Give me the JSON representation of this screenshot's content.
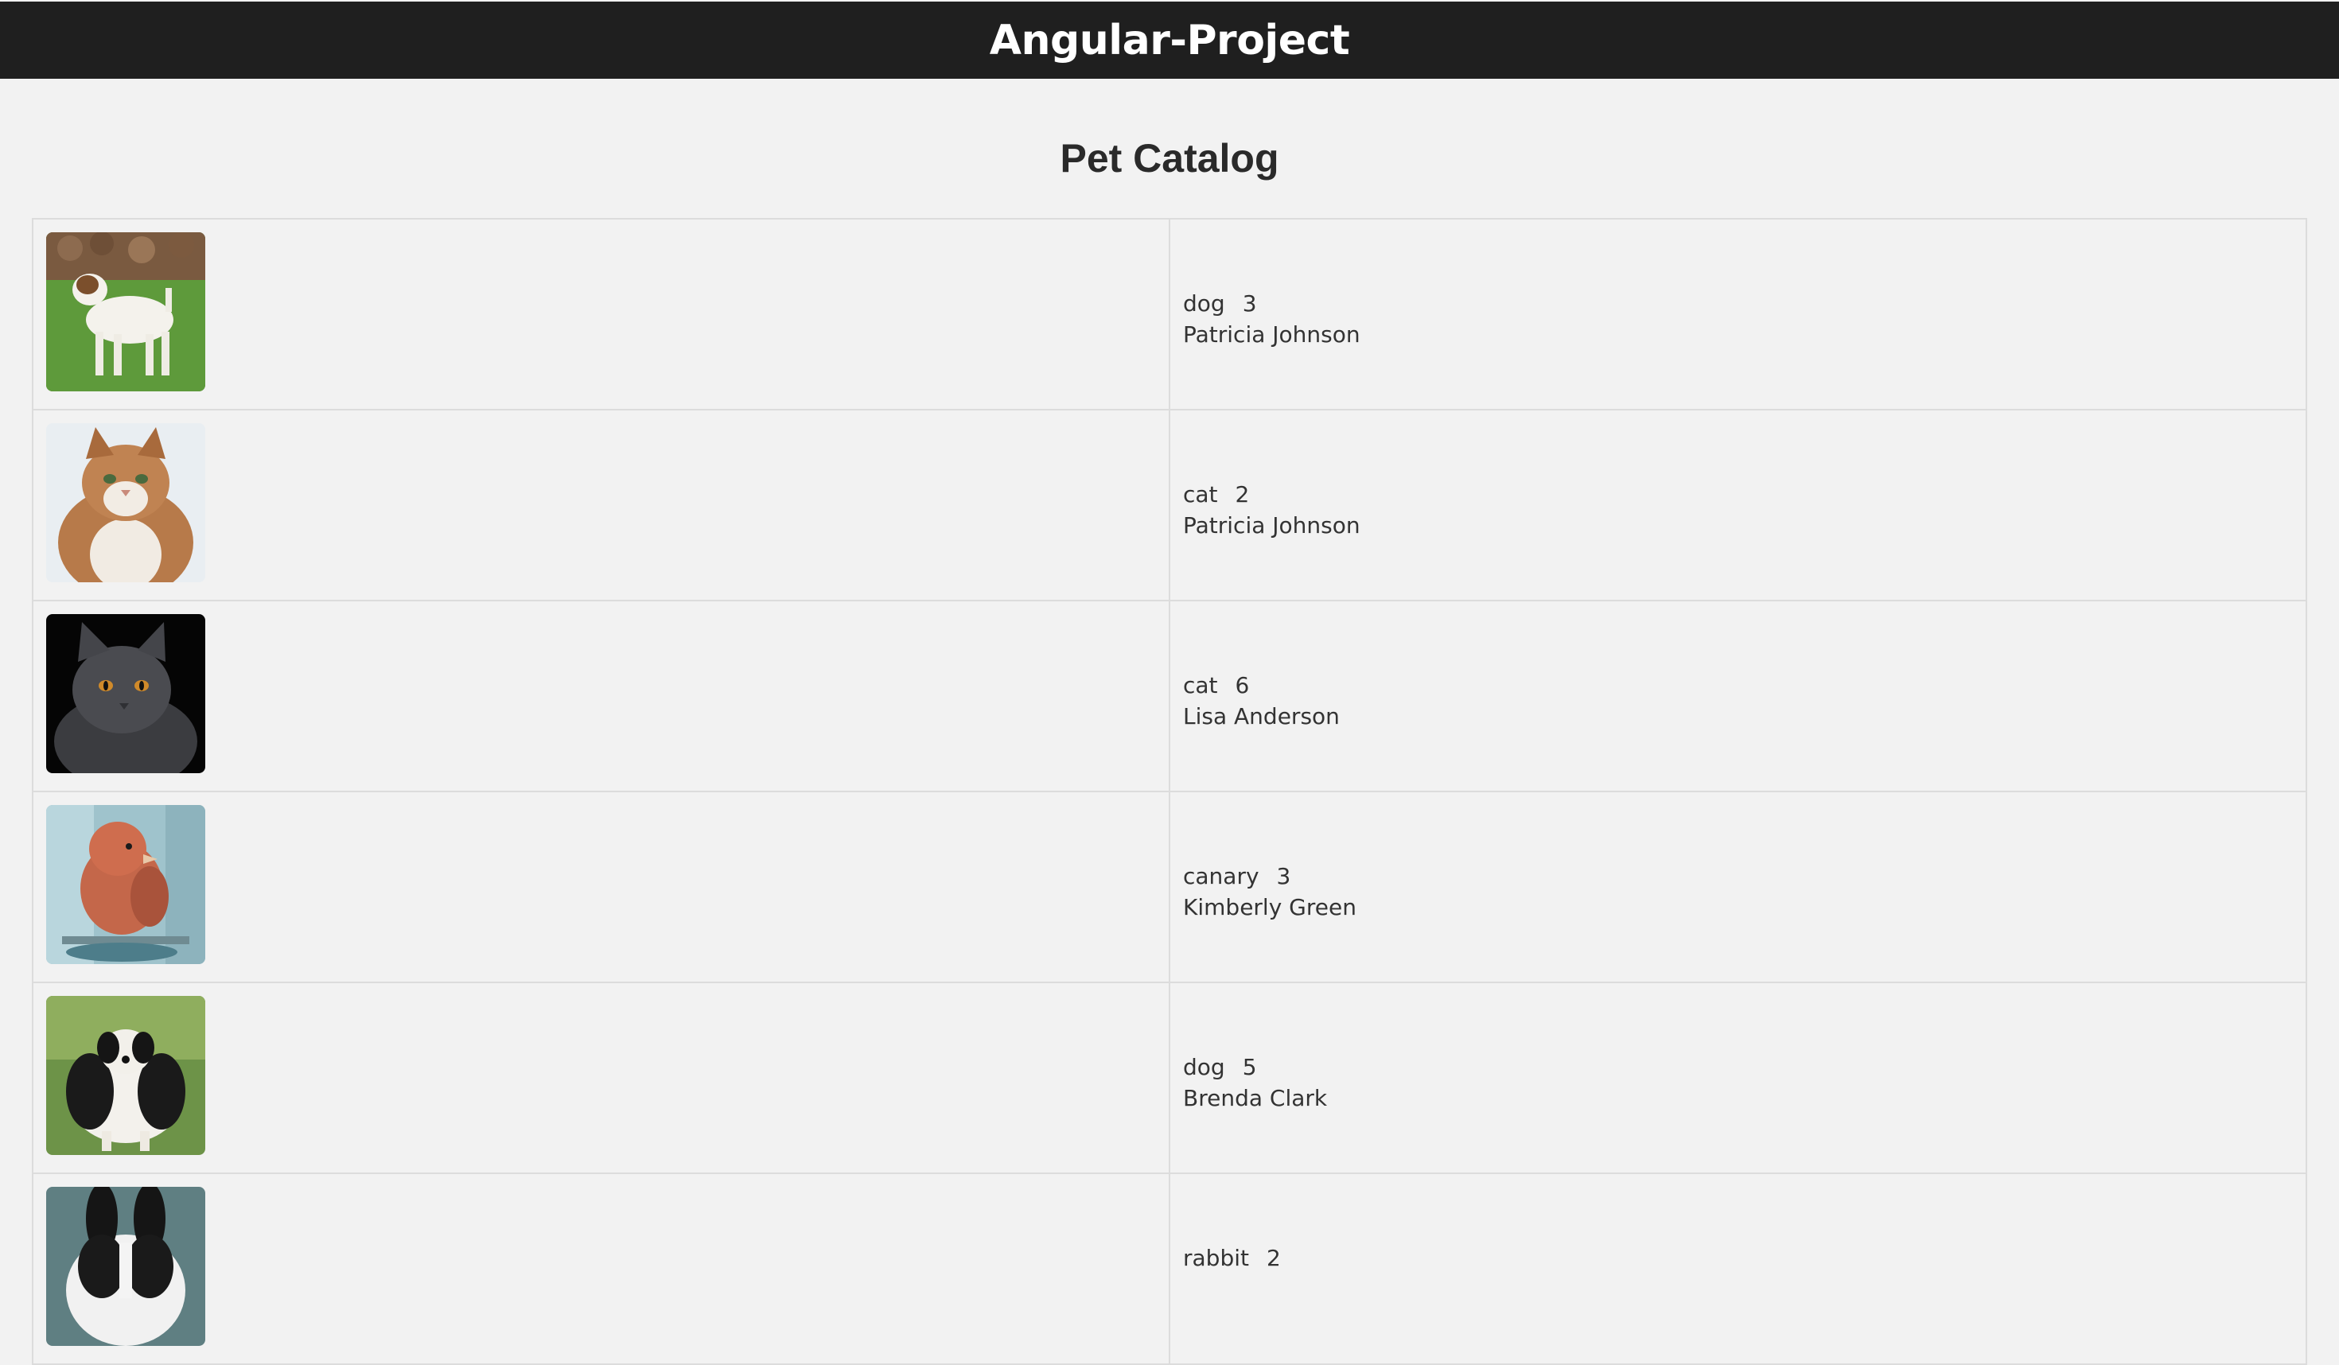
{
  "app": {
    "title": "Angular-Project"
  },
  "page": {
    "heading": "Pet Catalog"
  },
  "pets": [
    {
      "type": "dog",
      "age": "3",
      "owner": "Patricia Johnson",
      "photo_icon": "jack-russell-dog-photo"
    },
    {
      "type": "cat",
      "age": "2",
      "owner": "Patricia Johnson",
      "photo_icon": "long-haired-cat-photo"
    },
    {
      "type": "cat",
      "age": "6",
      "owner": "Lisa Anderson",
      "photo_icon": "gray-cat-photo"
    },
    {
      "type": "canary",
      "age": "3",
      "owner": "Kimberly Green",
      "photo_icon": "red-canary-photo"
    },
    {
      "type": "dog",
      "age": "5",
      "owner": "Brenda Clark",
      "photo_icon": "black-white-dog-photo"
    },
    {
      "type": "rabbit",
      "age": "2",
      "owner": "",
      "photo_icon": "black-white-rabbit-photo"
    }
  ]
}
